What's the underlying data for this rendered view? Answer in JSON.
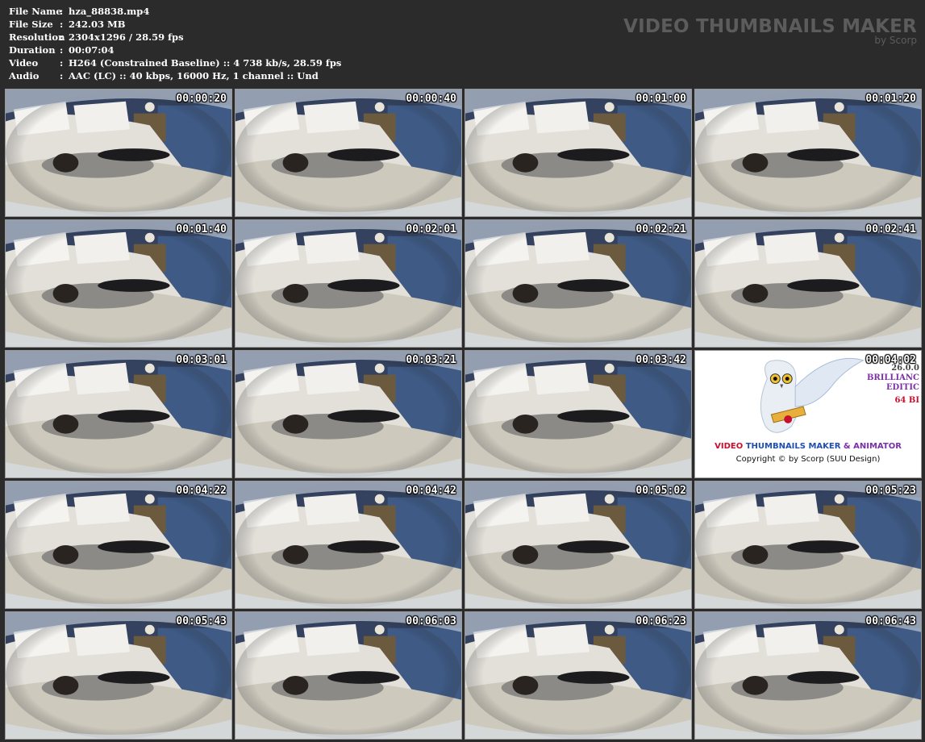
{
  "meta": [
    {
      "key": "File Name",
      "value": "hza_88838.mp4"
    },
    {
      "key": "File Size",
      "value": "242.03 MB"
    },
    {
      "key": "Resolution",
      "value": "2304x1296 / 28.59 fps"
    },
    {
      "key": "Duration",
      "value": "00:07:04"
    },
    {
      "key": "Video",
      "value": "H264 (Constrained Baseline) :: 4 738 kb/s, 28.59 fps"
    },
    {
      "key": "Audio",
      "value": "AAC (LC) :: 40 kbps, 16000 Hz, 1 channel :: Und"
    }
  ],
  "separator": ":",
  "brand": {
    "title": "VIDEO THUMBNAILS MAKER",
    "subtitle": "by Scorp"
  },
  "thumbnails": [
    "00:00:20",
    "00:00:40",
    "00:01:00",
    "00:01:20",
    "00:01:40",
    "00:02:01",
    "00:02:21",
    "00:02:41",
    "00:03:01",
    "00:03:21",
    "00:03:42",
    "00:04:02",
    "00:04:22",
    "00:04:42",
    "00:05:02",
    "00:05:23",
    "00:05:43",
    "00:06:03",
    "00:06:23",
    "00:06:43"
  ],
  "logo": {
    "word1": "VIDEO",
    "word2": "THUMBNAILS MAKER",
    "word3": "& ANIMATOR",
    "copyright": "Copyright © by Scorp (SUU Design)",
    "version": "26.0.0",
    "edition1": "BRILLIANC",
    "edition2": "EDITIC",
    "bits": "64 BI"
  },
  "colors": {
    "background": "#2b2b2b",
    "brand_text": "#5c5c5c"
  }
}
